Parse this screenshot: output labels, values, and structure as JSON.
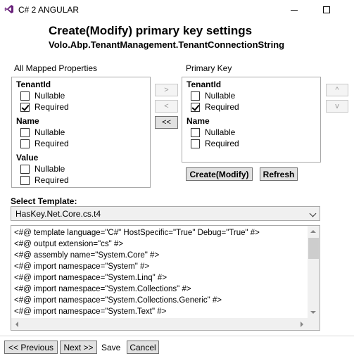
{
  "window": {
    "title": "C# 2 ANGULAR"
  },
  "header": {
    "title": "Create(Modify) primary key settings",
    "subtitle": "Volo.Abp.TenantManagement.TenantConnectionString"
  },
  "mapped": {
    "label": "All Mapped Properties",
    "properties": [
      {
        "name": "TenantId",
        "nullable_label": "Nullable",
        "nullable": false,
        "required_label": "Required",
        "required": true
      },
      {
        "name": "Name",
        "nullable_label": "Nullable",
        "nullable": false,
        "required_label": "Required",
        "required": false
      },
      {
        "name": "Value",
        "nullable_label": "Nullable",
        "nullable": false,
        "required_label": "Required",
        "required": false
      }
    ]
  },
  "transfer": {
    "add": ">",
    "remove": "<",
    "remove_all": "<<"
  },
  "primary": {
    "label": "Primary Key",
    "properties": [
      {
        "name": "TenantId",
        "nullable_label": "Nullable",
        "nullable": false,
        "required_label": "Required",
        "required": true
      },
      {
        "name": "Name",
        "nullable_label": "Nullable",
        "nullable": false,
        "required_label": "Required",
        "required": false
      }
    ]
  },
  "order": {
    "up": "^",
    "down": "v"
  },
  "actions": {
    "create_modify": "Create(Modify)",
    "refresh": "Refresh"
  },
  "template": {
    "label": "Select Template:",
    "selected": "HasKey.Net.Core.cs.t4",
    "code_lines": [
      "<#@ template language=\"C#\" HostSpecific=\"True\" Debug=\"True\" #>",
      "<#@ output extension=\"cs\" #>",
      "<#@ assembly name=\"System.Core\" #>",
      "<#@ import namespace=\"System\" #>",
      "<#@ import namespace=\"System.Linq\" #>",
      "<#@ import namespace=\"System.Collections\" #>",
      "<#@ import namespace=\"System.Collections.Generic\" #>",
      "<#@ import namespace=\"System.Text\" #>"
    ]
  },
  "footer": {
    "previous": "<< Previous",
    "next": "Next >>",
    "save": "Save",
    "cancel": "Cancel"
  }
}
